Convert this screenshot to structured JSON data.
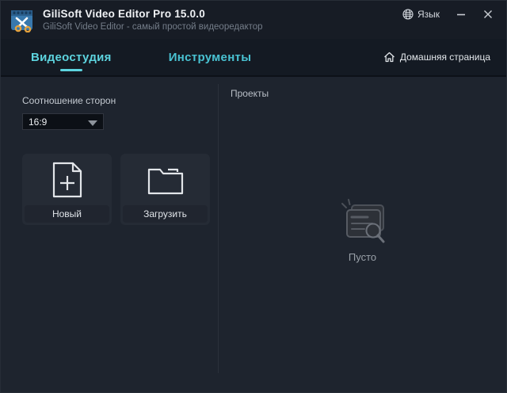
{
  "window": {
    "title": "GiliSoft Video Editor Pro 15.0.0",
    "subtitle": "GiliSoft Video Editor - самый простой видеоредактор",
    "controls": {
      "language_label": "Язык"
    }
  },
  "tabs": [
    {
      "label": "Видеостудия",
      "active": true
    },
    {
      "label": "Инструменты",
      "active": false
    }
  ],
  "home_button": {
    "label": "Домашняя страница"
  },
  "left_panel": {
    "aspect_ratio_label": "Соотношение сторон",
    "aspect_ratio_value": "16:9",
    "actions": [
      {
        "label": "Новый",
        "icon": "new-document-icon"
      },
      {
        "label": "Загрузить",
        "icon": "open-folder-icon"
      }
    ]
  },
  "right_panel": {
    "header": "Проекты",
    "empty_text": "Пусто"
  },
  "icons": {
    "logo": "film-scissors-logo",
    "language": "globe-icon",
    "minimize": "minimize-icon",
    "close": "close-icon",
    "home": "home-icon",
    "dropdown": "chevron-down-icon",
    "empty": "empty-projects-icon"
  },
  "colors": {
    "accent": "#5dd4df",
    "background": "#1e242e",
    "titlebar": "#171c25",
    "tabbar": "#141a23",
    "card": "#252b35"
  }
}
